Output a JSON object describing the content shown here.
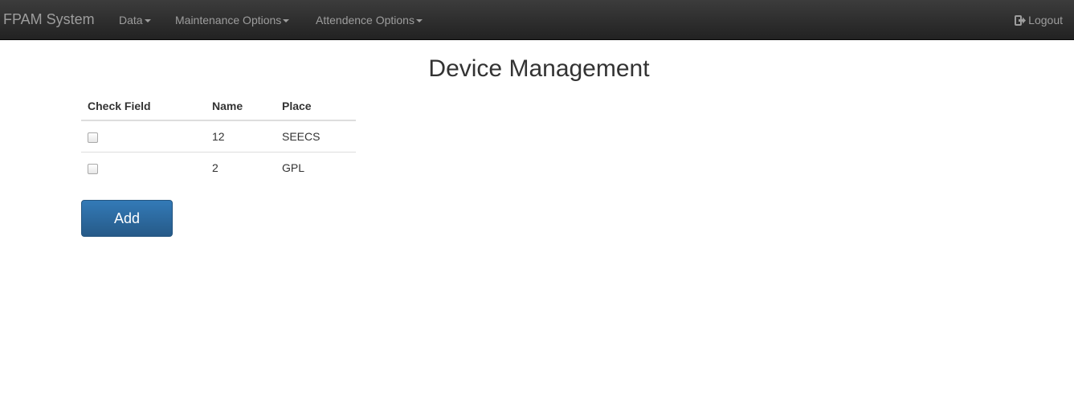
{
  "navbar": {
    "brand": "FPAM System",
    "menus": [
      {
        "label": "Data"
      },
      {
        "label": "Maintenance Options"
      },
      {
        "label": "Attendence Options"
      }
    ],
    "logout_label": "Logout",
    "logout_icon": "log-out-icon"
  },
  "main": {
    "title": "Device Management",
    "table": {
      "columns": [
        "Check Field",
        "Name",
        "Place"
      ],
      "rows": [
        {
          "checked": false,
          "name": "12",
          "place": "SEECS"
        },
        {
          "checked": false,
          "name": "2",
          "place": "GPL"
        }
      ]
    },
    "add_button_label": "Add"
  },
  "colors": {
    "navbar_bg": "#222222",
    "nav_text": "#9d9d9d",
    "primary_button": "#337ab7"
  }
}
